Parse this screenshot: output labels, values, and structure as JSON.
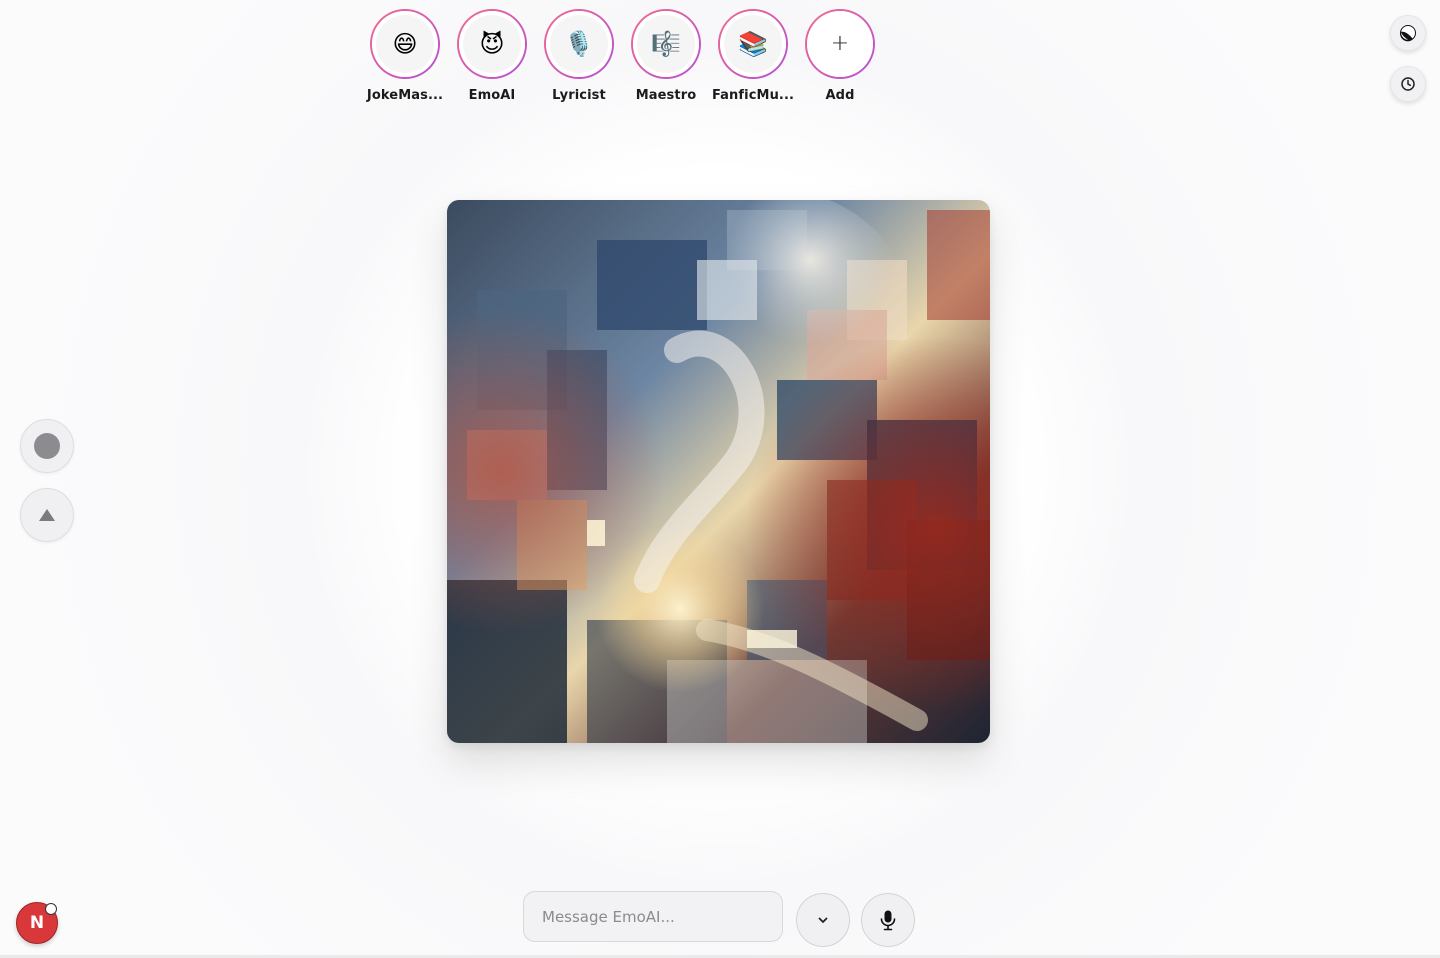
{
  "agents": [
    {
      "name": "JokeMas...",
      "emoji": "😄",
      "icon": "grinning-face-icon"
    },
    {
      "name": "EmoAI",
      "emoji": "😈",
      "icon": "smiling-devil-icon"
    },
    {
      "name": "Lyricist",
      "emoji": "🎙️",
      "icon": "microphone-icon"
    },
    {
      "name": "Maestro",
      "emoji": "🎼",
      "icon": "musical-score-icon"
    },
    {
      "name": "FanficMu...",
      "emoji": "📚",
      "icon": "books-icon"
    },
    {
      "name": "Add",
      "emoji": "+",
      "icon": "plus-icon"
    }
  ],
  "controls": {
    "theme_icon": "theme-toggle-icon",
    "history_icon": "clock-icon",
    "stop_icon": "circle-icon",
    "up_icon": "triangle-up-icon"
  },
  "composer": {
    "placeholder": "Message EmoAI...",
    "dropdown_icon": "chevron-down-icon",
    "mic_icon": "microphone-icon"
  },
  "user": {
    "initial": "N"
  },
  "colors": {
    "ring_start": "#f36a8a",
    "ring_end": "#b44fd8",
    "avatar_red": "#d9383a"
  }
}
